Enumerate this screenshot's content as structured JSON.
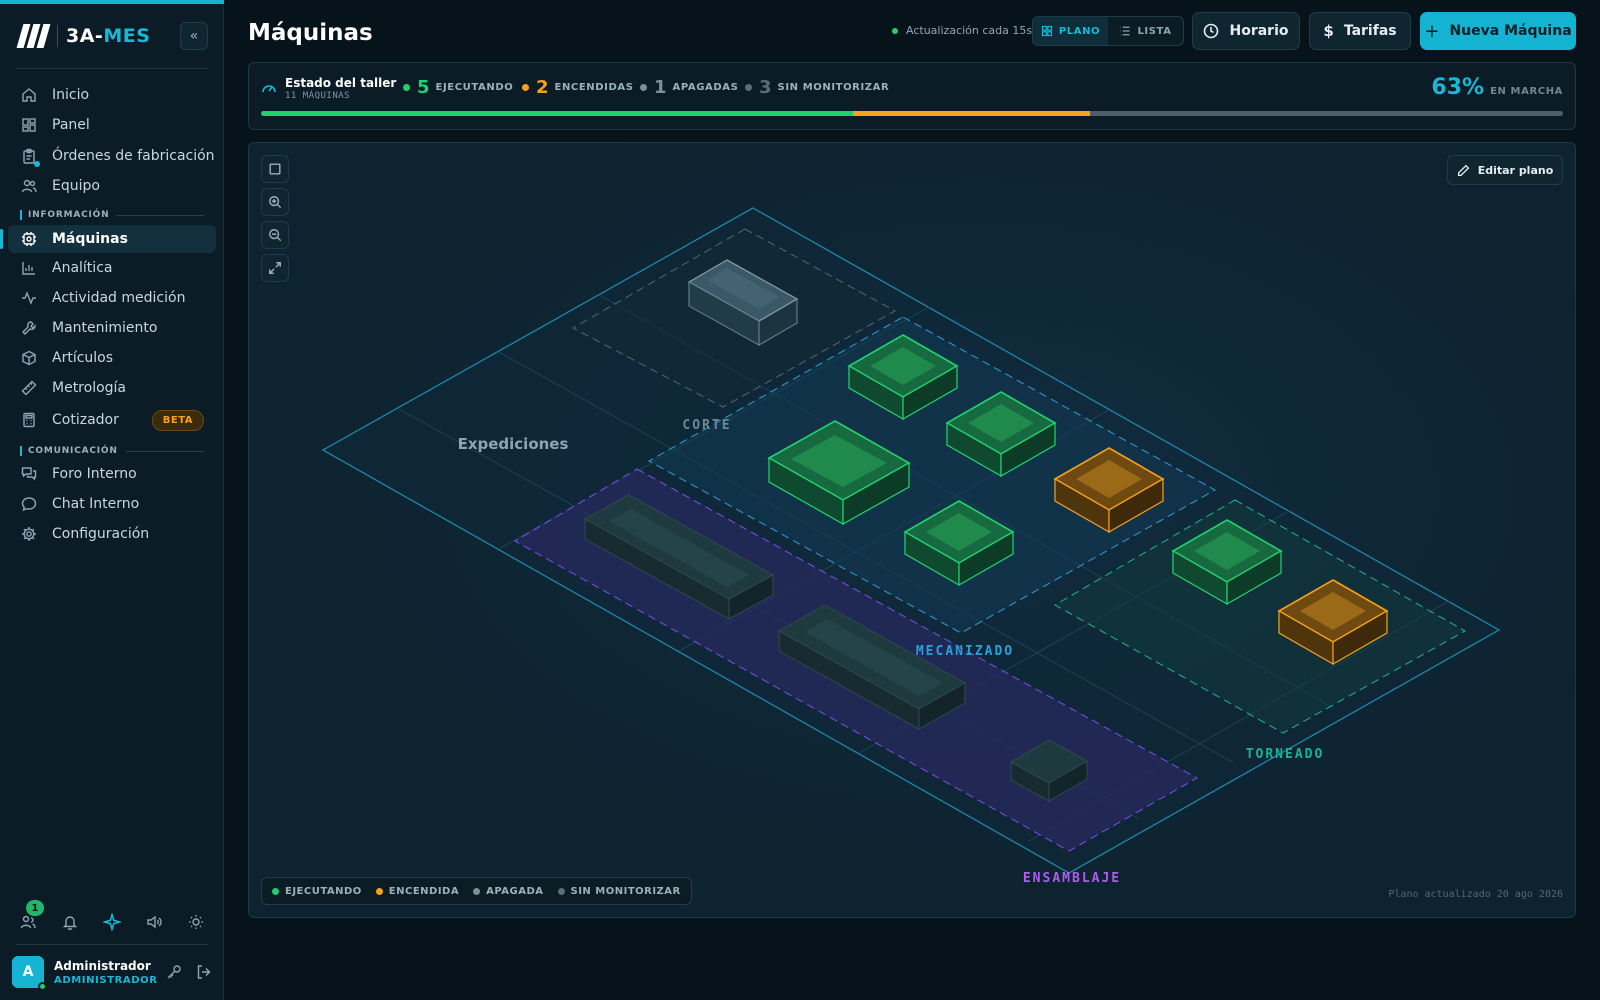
{
  "brand": {
    "name_a": "3A-",
    "name_b": "MES"
  },
  "sidebar": {
    "items": [
      {
        "label": "Inicio"
      },
      {
        "label": "Panel"
      },
      {
        "label": "Órdenes de fabricación"
      },
      {
        "label": "Equipo"
      },
      {
        "label": "Máquinas"
      },
      {
        "label": "Analítica"
      },
      {
        "label": "Actividad medición"
      },
      {
        "label": "Mantenimiento"
      },
      {
        "label": "Artículos"
      },
      {
        "label": "Metrología"
      },
      {
        "label": "Cotizador"
      },
      {
        "label": "Foro Interno"
      },
      {
        "label": "Chat Interno"
      },
      {
        "label": "Configuración"
      }
    ],
    "section_info": "INFORMACIÓN",
    "section_comm": "COMUNICACIÓN",
    "beta_badge": "BETA",
    "notification_count": "1"
  },
  "user": {
    "initial": "A",
    "name": "Administrador",
    "role": "ADMINISTRADOR"
  },
  "header": {
    "title": "Máquinas",
    "refresh_text": "Actualización cada 15s",
    "view_plano": "PLANO",
    "view_lista": "LISTA",
    "schedule_btn": "Horario",
    "rates_btn": "Tarifas",
    "new_machine_btn": "Nueva Máquina"
  },
  "status": {
    "title": "Estado del taller",
    "subtitle": "11 MÁQUINAS",
    "items": [
      {
        "count": "5",
        "label": "EJECUTANDO",
        "color": "#1fd06e"
      },
      {
        "count": "2",
        "label": "ENCENDIDAS",
        "color": "#f7a21c"
      },
      {
        "count": "1",
        "label": "APAGADAS",
        "color": "#7f8f98"
      },
      {
        "count": "3",
        "label": "SIN MONITORIZAR",
        "color": "#5b6d77"
      }
    ],
    "percent": "63%",
    "percent_label": "EN MARCHA",
    "bar_fraction": {
      "running": 0.455,
      "on": 0.182,
      "rest": 0.363
    }
  },
  "plan": {
    "edit_btn": "Editar plano",
    "zones": {
      "expediciones": "Expediciones",
      "corte": "CORTE",
      "mecanizado": "MECANIZADO",
      "torneado": "TORNEADO",
      "ensamblaje": "ENSAMBLAJE"
    },
    "legend": [
      {
        "label": "EJECUTANDO",
        "color": "#1fd06e"
      },
      {
        "label": "ENCENDIDA",
        "color": "#f7a21c"
      },
      {
        "label": "APAGADA",
        "color": "#7f8f98"
      },
      {
        "label": "SIN MONITORIZAR",
        "color": "#5b6d77"
      }
    ],
    "updated": "Plano actualizado 20 ago 2026"
  },
  "icons": {
    "home": "home-icon",
    "panel": "grid-icon",
    "orders": "clipboard-icon",
    "team": "users-icon",
    "machines": "chip-icon",
    "analytics": "bar-chart-icon",
    "activity": "activity-icon",
    "maintenance": "wrench-icon",
    "articles": "box-icon",
    "metrology": "ruler-icon",
    "quoter": "calculator-icon",
    "forum": "messages-icon",
    "chat": "chat-icon",
    "settings": "gear-icon"
  }
}
